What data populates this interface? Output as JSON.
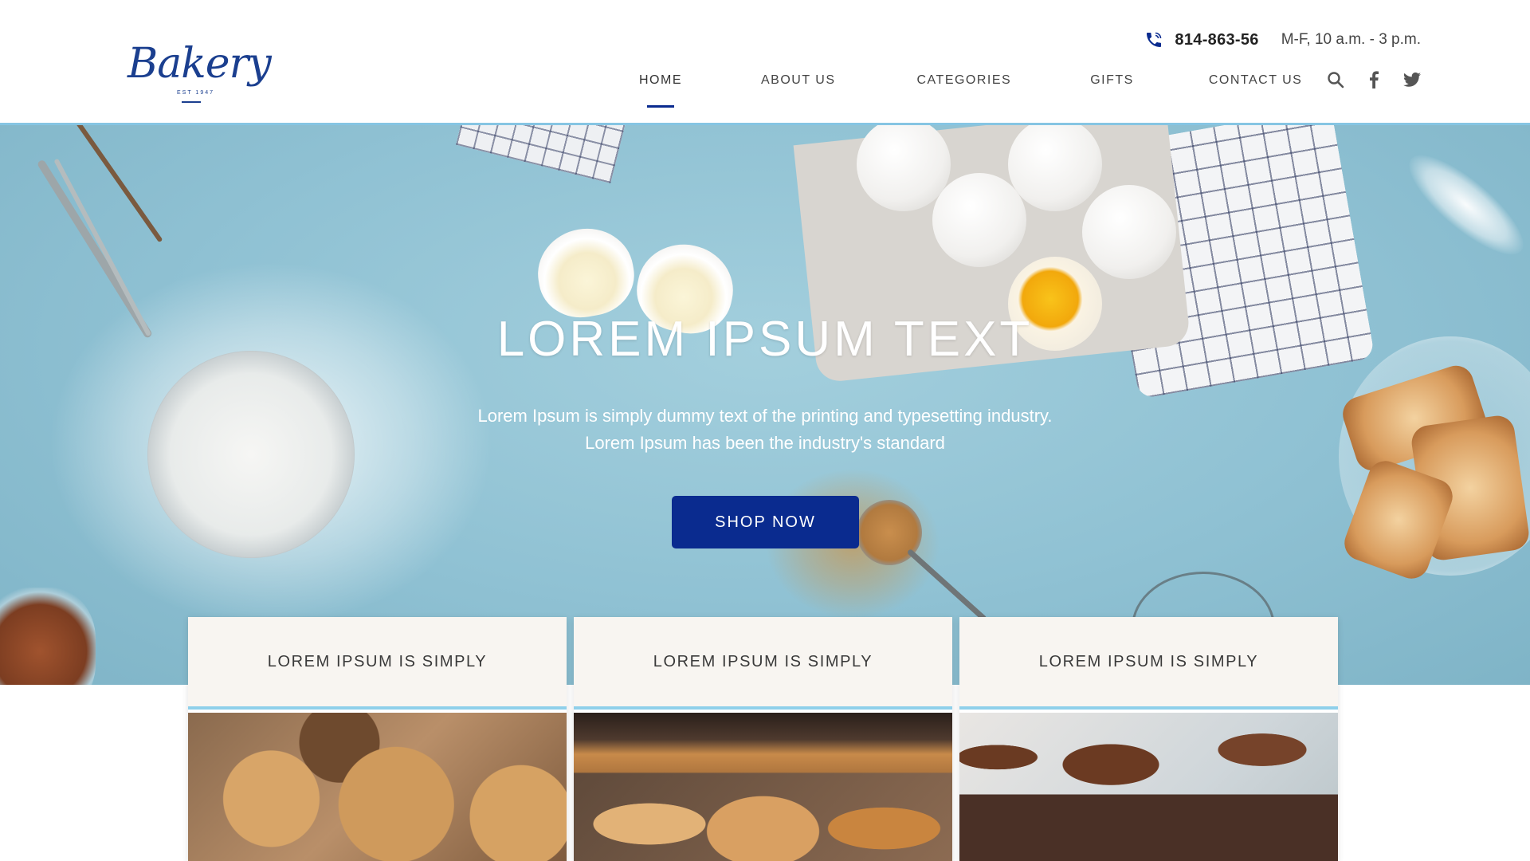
{
  "brand": {
    "logo_text": "Bakery",
    "logo_tagline": "EST 1947"
  },
  "contact": {
    "phone": "814-863-56",
    "hours": "M-F, 10 a.m. - 3 p.m."
  },
  "nav": {
    "items": [
      {
        "label": "HOME",
        "active": true
      },
      {
        "label": "ABOUT US",
        "active": false
      },
      {
        "label": "CATEGORIES",
        "active": false
      },
      {
        "label": "GIFTS",
        "active": false
      },
      {
        "label": "CONTACT US",
        "active": false
      }
    ],
    "icons": [
      "search-icon",
      "facebook-icon",
      "twitter-icon"
    ]
  },
  "hero": {
    "title": "LOREM IPSUM TEXT",
    "subtitle_line1": "Lorem Ipsum is simply dummy text of the printing and typesetting industry.",
    "subtitle_line2": "Lorem Ipsum has been the industry's standard",
    "cta_label": "SHOP NOW"
  },
  "cards": [
    {
      "title": "LOREM IPSUM IS SIMPLY",
      "image": "cookies"
    },
    {
      "title": "LOREM IPSUM IS SIMPLY",
      "image": "pastries"
    },
    {
      "title": "LOREM IPSUM IS SIMPLY",
      "image": "cupcakes"
    }
  ],
  "colors": {
    "accent": "#0a2b8f",
    "logo": "#1b3f8f",
    "divider": "#86c5e3",
    "hero_bg": "#8fc1d3"
  }
}
